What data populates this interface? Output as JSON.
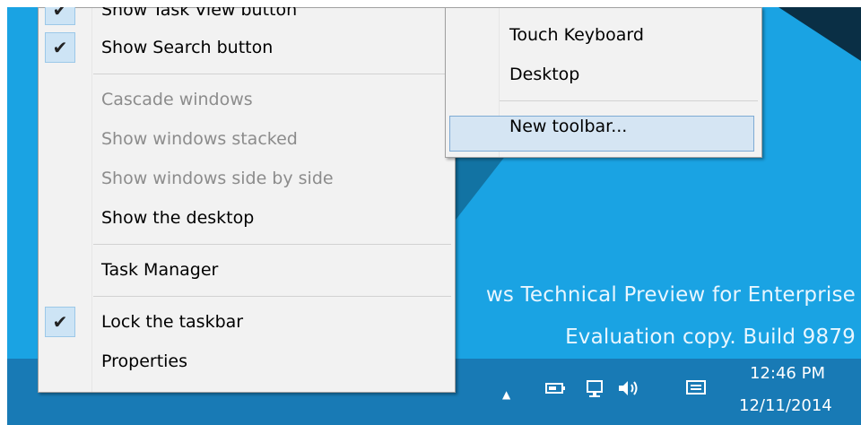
{
  "main_menu": {
    "items": [
      {
        "label": "Show Task View button",
        "checked": true,
        "enabled": true
      },
      {
        "label": "Show Search button",
        "checked": true,
        "enabled": true
      },
      {
        "label": "Cascade windows",
        "checked": false,
        "enabled": false
      },
      {
        "label": "Show windows stacked",
        "checked": false,
        "enabled": false
      },
      {
        "label": "Show windows side by side",
        "checked": false,
        "enabled": false
      },
      {
        "label": "Show the desktop",
        "checked": false,
        "enabled": true
      },
      {
        "label": "Task Manager",
        "checked": false,
        "enabled": true
      },
      {
        "label": "Lock the taskbar",
        "checked": true,
        "enabled": true
      },
      {
        "label": "Properties",
        "checked": false,
        "enabled": true
      }
    ],
    "check_glyph": "✔"
  },
  "toolbars_submenu": {
    "items": [
      {
        "label": "Touch Keyboard"
      },
      {
        "label": "Desktop"
      },
      {
        "label": "New toolbar...",
        "highlighted": true
      }
    ]
  },
  "watermark": {
    "line1": "ws Technical Preview for Enterprise",
    "line2": "Evaluation copy. Build 9879"
  },
  "tray": {
    "icons": [
      "chevron-up-icon",
      "power-icon",
      "network-icon",
      "speaker-icon",
      "action-center-icon"
    ],
    "glyphs": {
      "chevron": "▲",
      "power": "▭",
      "network": "⊡",
      "speaker": "🔈︎",
      "message": "▤"
    }
  },
  "clock": {
    "time": "12:46 PM",
    "date": "12/11/2014"
  },
  "colors": {
    "desktop": "#1aa3e3",
    "taskbar": "#187ab5",
    "menu_bg": "#f2f2f2",
    "highlight": "#d5e5f3"
  }
}
